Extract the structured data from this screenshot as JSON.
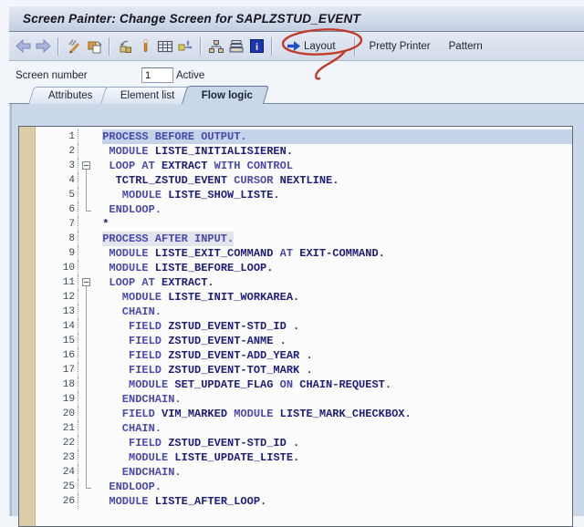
{
  "window": {
    "title": "Screen Painter: Change Screen for SAPLZSTUD_EVENT"
  },
  "toolbar": {
    "icons": [
      "back-icon",
      "forward-icon",
      "display-change-icon",
      "copy-screen-icon",
      "other-screen-icon",
      "activate-icon",
      "table-control-icon",
      "move-field-icon",
      "hierarchy-icon",
      "print-list-icon",
      "info-icon",
      "layout-arrow-icon"
    ],
    "layout_label": "Layout",
    "pretty_printer_label": "Pretty Printer",
    "pattern_label": "Pattern",
    "annotation": "hand-drawn red ellipse circling the Layout button",
    "annotation_color": "#c23b2c"
  },
  "header": {
    "screen_number_label": "Screen number",
    "screen_number_value": "1",
    "status": "Active"
  },
  "tabs": [
    {
      "label": "Attributes",
      "active": false
    },
    {
      "label": "Element list",
      "active": false
    },
    {
      "label": "Flow logic",
      "active": true
    }
  ],
  "editor": {
    "language": "ABAP flow logic",
    "colors": {
      "keyword": "#4a49ae",
      "identifier": "#1d1d7c",
      "selected_row": "#c5d2e8",
      "breakpoint_margin": "#dbcda6"
    },
    "lines": [
      {
        "n": 1,
        "ind": 1,
        "hl": "row",
        "fold": null,
        "t": [
          [
            "k",
            "PROCESS BEFORE OUTPUT."
          ]
        ]
      },
      {
        "n": 2,
        "ind": 2,
        "hl": null,
        "fold": null,
        "t": [
          [
            "k",
            "MODULE"
          ],
          [
            "i",
            " LISTE_INITIALISIEREN."
          ]
        ]
      },
      {
        "n": 3,
        "ind": 2,
        "hl": null,
        "fold": "open",
        "t": [
          [
            "k",
            "LOOP AT"
          ],
          [
            "i",
            " EXTRACT"
          ],
          [
            "k",
            " WITH CONTROL"
          ]
        ]
      },
      {
        "n": 4,
        "ind": 3,
        "hl": null,
        "fold": "bar",
        "t": [
          [
            "i",
            "TCTRL_ZSTUD_EVENT"
          ],
          [
            "k",
            " CURSOR"
          ],
          [
            "i",
            " NEXTLINE."
          ]
        ]
      },
      {
        "n": 5,
        "ind": 4,
        "hl": null,
        "fold": "bar",
        "t": [
          [
            "k",
            "MODULE"
          ],
          [
            "i",
            " LISTE_SHOW_LISTE."
          ]
        ]
      },
      {
        "n": 6,
        "ind": 2,
        "hl": null,
        "fold": "end",
        "t": [
          [
            "k",
            "ENDLOOP."
          ]
        ]
      },
      {
        "n": 7,
        "ind": 1,
        "hl": null,
        "fold": null,
        "t": [
          [
            "c",
            "*"
          ]
        ]
      },
      {
        "n": 8,
        "ind": 1,
        "hl": "text",
        "fold": null,
        "t": [
          [
            "k",
            "PROCESS AFTER INPUT."
          ]
        ]
      },
      {
        "n": 9,
        "ind": 2,
        "hl": null,
        "fold": null,
        "t": [
          [
            "k",
            "MODULE"
          ],
          [
            "i",
            " LISTE_EXIT_COMMAND"
          ],
          [
            "k",
            " AT"
          ],
          [
            "i",
            " EXIT-COMMAND."
          ]
        ]
      },
      {
        "n": 10,
        "ind": 2,
        "hl": null,
        "fold": null,
        "t": [
          [
            "k",
            "MODULE"
          ],
          [
            "i",
            " LISTE_BEFORE_LOOP."
          ]
        ]
      },
      {
        "n": 11,
        "ind": 2,
        "hl": null,
        "fold": "open",
        "t": [
          [
            "k",
            "LOOP AT"
          ],
          [
            "i",
            " EXTRACT."
          ]
        ]
      },
      {
        "n": 12,
        "ind": 4,
        "hl": null,
        "fold": "bar",
        "t": [
          [
            "k",
            "MODULE"
          ],
          [
            "i",
            " LISTE_INIT_WORKAREA."
          ]
        ]
      },
      {
        "n": 13,
        "ind": 4,
        "hl": null,
        "fold": "bar",
        "t": [
          [
            "k",
            "CHAIN."
          ]
        ]
      },
      {
        "n": 14,
        "ind": 5,
        "hl": null,
        "fold": "bar",
        "t": [
          [
            "k",
            "FIELD"
          ],
          [
            "i",
            " ZSTUD_EVENT-STD_ID ."
          ]
        ]
      },
      {
        "n": 15,
        "ind": 5,
        "hl": null,
        "fold": "bar",
        "t": [
          [
            "k",
            "FIELD"
          ],
          [
            "i",
            " ZSTUD_EVENT-ANME ."
          ]
        ]
      },
      {
        "n": 16,
        "ind": 5,
        "hl": null,
        "fold": "bar",
        "t": [
          [
            "k",
            "FIELD"
          ],
          [
            "i",
            " ZSTUD_EVENT-ADD_YEAR ."
          ]
        ]
      },
      {
        "n": 17,
        "ind": 5,
        "hl": null,
        "fold": "bar",
        "t": [
          [
            "k",
            "FIELD"
          ],
          [
            "i",
            " ZSTUD_EVENT-TOT_MARK ."
          ]
        ]
      },
      {
        "n": 18,
        "ind": 5,
        "hl": null,
        "fold": "bar",
        "t": [
          [
            "k",
            "MODULE"
          ],
          [
            "i",
            " SET_UPDATE_FLAG"
          ],
          [
            "k",
            " ON"
          ],
          [
            "i",
            " CHAIN-REQUEST."
          ]
        ]
      },
      {
        "n": 19,
        "ind": 4,
        "hl": null,
        "fold": "bar",
        "t": [
          [
            "k",
            "ENDCHAIN."
          ]
        ]
      },
      {
        "n": 20,
        "ind": 4,
        "hl": null,
        "fold": "bar",
        "t": [
          [
            "k",
            "FIELD"
          ],
          [
            "i",
            " VIM_MARKED"
          ],
          [
            "k",
            " MODULE"
          ],
          [
            "i",
            " LISTE_MARK_CHECKBOX."
          ]
        ]
      },
      {
        "n": 21,
        "ind": 4,
        "hl": null,
        "fold": "bar",
        "t": [
          [
            "k",
            "CHAIN."
          ]
        ]
      },
      {
        "n": 22,
        "ind": 5,
        "hl": null,
        "fold": "bar",
        "t": [
          [
            "k",
            "FIELD"
          ],
          [
            "i",
            " ZSTUD_EVENT-STD_ID ."
          ]
        ]
      },
      {
        "n": 23,
        "ind": 5,
        "hl": null,
        "fold": "bar",
        "t": [
          [
            "k",
            "MODULE"
          ],
          [
            "i",
            " LISTE_UPDATE_LISTE."
          ]
        ]
      },
      {
        "n": 24,
        "ind": 4,
        "hl": null,
        "fold": "bar",
        "t": [
          [
            "k",
            "ENDCHAIN."
          ]
        ]
      },
      {
        "n": 25,
        "ind": 2,
        "hl": null,
        "fold": "end",
        "t": [
          [
            "k",
            "ENDLOOP."
          ]
        ]
      },
      {
        "n": 26,
        "ind": 2,
        "hl": null,
        "fold": null,
        "t": [
          [
            "k",
            "MODULE"
          ],
          [
            "i",
            " LISTE_AFTER_LOOP."
          ]
        ]
      }
    ]
  }
}
